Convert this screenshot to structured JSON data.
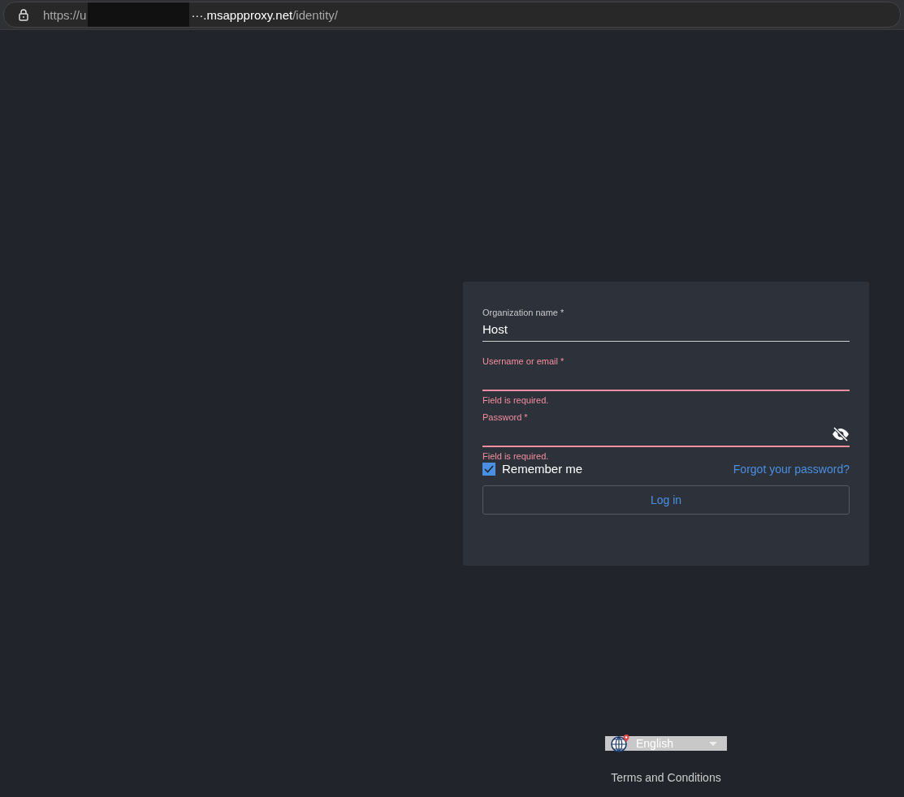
{
  "address_bar": {
    "scheme": "https://u",
    "host": "···.msappproxy.net",
    "path": "/identity/"
  },
  "login_form": {
    "fields": [
      {
        "kind": "text",
        "label": "Organization name *",
        "value": "Host",
        "error": false
      },
      {
        "kind": "text",
        "label": "Username or email *",
        "error": true,
        "message": "Field is required."
      },
      {
        "kind": "password",
        "label": "Password *",
        "error": true,
        "message": "Field is required."
      }
    ],
    "remember_me": {
      "label": "Remember me",
      "checked": true
    },
    "forgot_link": "Forgot your password?",
    "submit": "Log in"
  },
  "footer": {
    "language": "English",
    "terms_link": "Terms and Conditions"
  }
}
